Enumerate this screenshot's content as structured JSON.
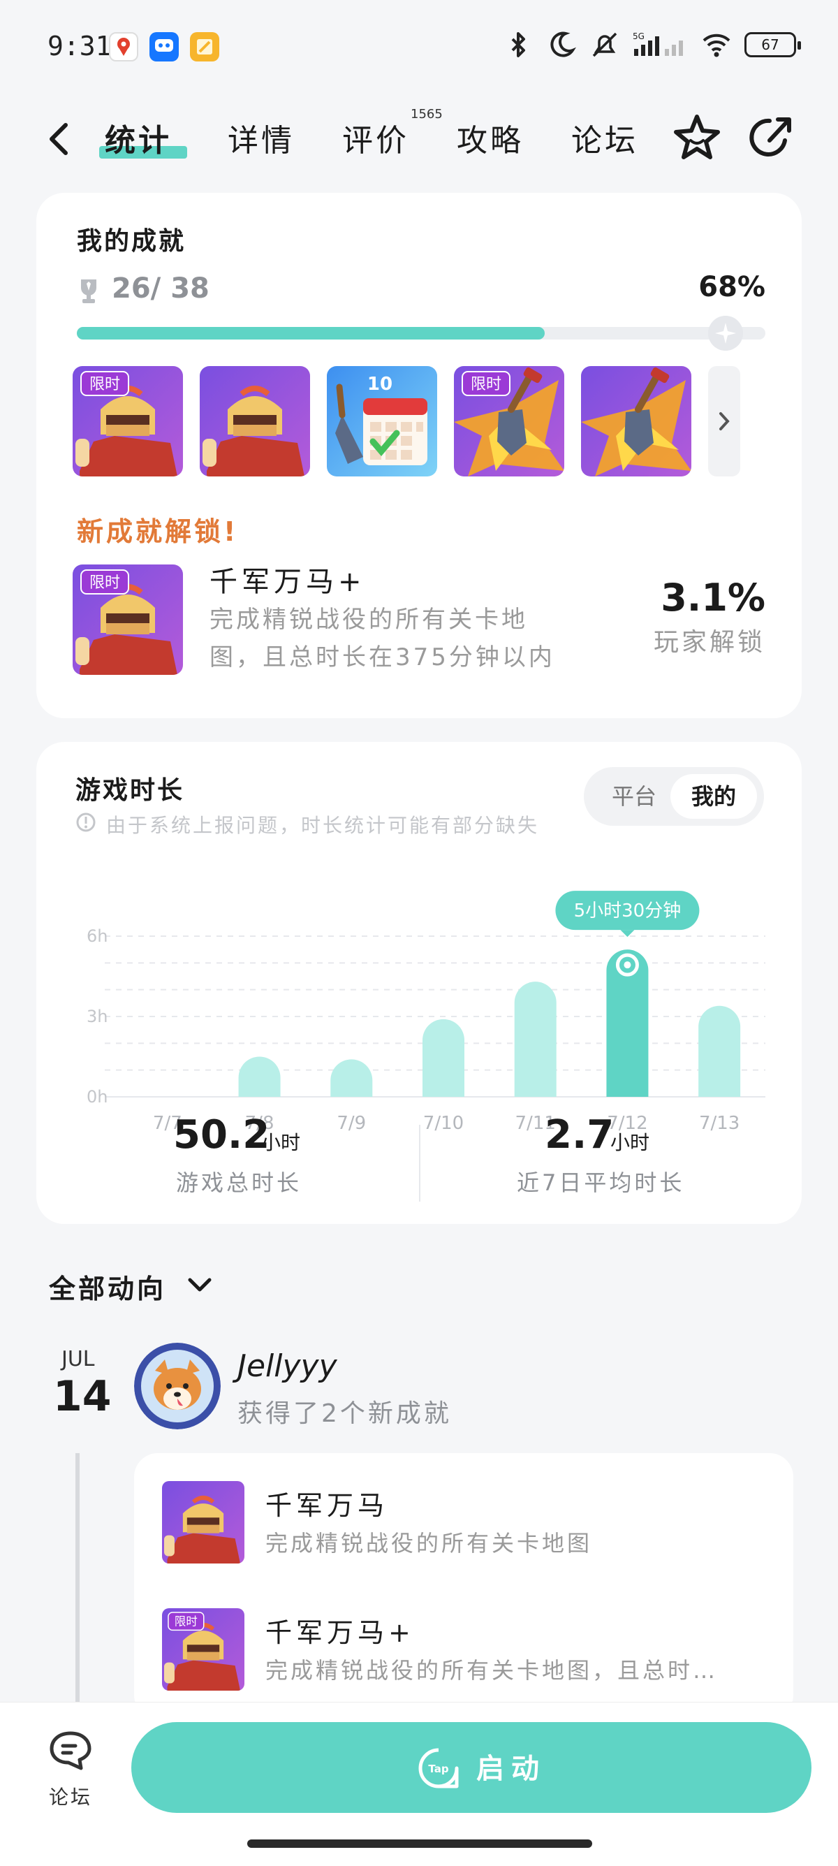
{
  "status_bar": {
    "time": "9:31",
    "network": "5G",
    "battery": "67"
  },
  "nav": {
    "tabs": [
      {
        "label": "统计",
        "active": true
      },
      {
        "label": "详情",
        "active": false
      },
      {
        "label": "评价",
        "active": false
      },
      {
        "label": "攻略",
        "active": false
      },
      {
        "label": "论坛",
        "active": false
      }
    ],
    "review_count": "1565"
  },
  "achievement": {
    "title": "我的成就",
    "count": "26/ 38",
    "percent": "68%",
    "progress": 0.68,
    "badges": [
      {
        "kind": "knight",
        "limited": true,
        "limited_label": "限时"
      },
      {
        "kind": "knight",
        "limited": false
      },
      {
        "kind": "calendar",
        "limited": false,
        "number": "10"
      },
      {
        "kind": "shovel",
        "limited": true,
        "limited_label": "限时"
      },
      {
        "kind": "shovel",
        "limited": false
      }
    ],
    "new_unlock": {
      "title": "新成就解锁!",
      "badge_label": "限时",
      "name": "千军万马+",
      "desc_line1": "完成精锐战役的所有关卡地",
      "desc_line2": "图，且总时长在375分钟以内",
      "rate": "3.1%",
      "rate_label": "玩家解锁"
    }
  },
  "playtime": {
    "title": "游戏时长",
    "toggle": {
      "platform": "平台",
      "mine": "我的",
      "selected": "mine"
    },
    "notice": "由于系统上报问题，时长统计可能有部分缺失",
    "stats": {
      "total_value": "50.2",
      "total_unit": "小时",
      "total_label": "游戏总时长",
      "avg_value": "2.7",
      "avg_unit": "小时",
      "avg_label": "近7日平均时长"
    }
  },
  "chart_data": {
    "type": "bar",
    "categories": [
      "7/7",
      "7/8",
      "7/9",
      "7/10",
      "7/11",
      "7/12",
      "7/13"
    ],
    "values": [
      0,
      1.5,
      1.4,
      2.9,
      4.3,
      5.5,
      3.4
    ],
    "ylim": [
      0,
      6
    ],
    "yticks": [
      "0h",
      "3h",
      "6h"
    ],
    "highlight_index": 5,
    "tooltip": "5小时30分钟",
    "grid": true,
    "colors": {
      "bar": "#b8efe8",
      "highlight": "#5fd4c5"
    }
  },
  "activity": {
    "header": "全部动向",
    "date_month": "JUL",
    "date_day": "14",
    "user_name": "Jellyyy",
    "user_action": "获得了2个新成就",
    "items": [
      {
        "name": "千军万马",
        "desc": "完成精锐战役的所有关卡地图",
        "limited": false
      },
      {
        "name": "千军万马+",
        "desc": "完成精锐战役的所有关卡地图，且总时…",
        "limited": true,
        "limited_label": "限时"
      }
    ]
  },
  "bottom_bar": {
    "forum_label": "论坛",
    "launch_label": "启动",
    "launch_icon_text": "Tap"
  },
  "colors": {
    "accent": "#5fd4c5",
    "unlock_orange": "#e27a38",
    "muted_text": "#9a9a9a",
    "limited_badge": "#9b3ad6"
  }
}
